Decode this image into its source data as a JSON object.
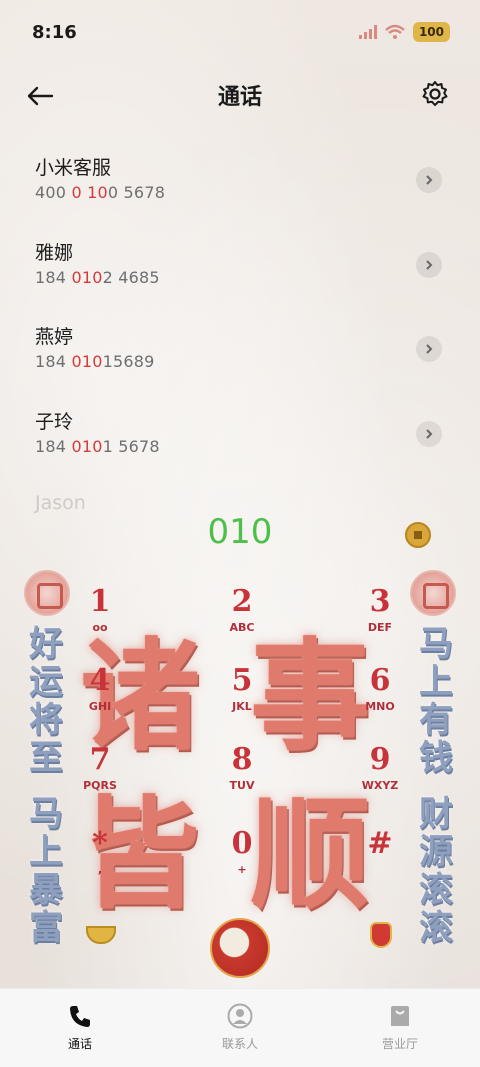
{
  "status_bar": {
    "time": "8:16",
    "battery": "100"
  },
  "header": {
    "title": "通话"
  },
  "contacts": [
    {
      "name": "小米客服",
      "num_a": "400 ",
      "num_hl": "0",
      "num_b": " ",
      "num_hl2": "10",
      "num_c": "0 5678"
    },
    {
      "name": "雅娜",
      "num_a": "184 ",
      "num_hl": "010",
      "num_b": "",
      "num_hl2": "",
      "num_c": "2 4685"
    },
    {
      "name": "燕婷",
      "num_a": "184 ",
      "num_hl": "010",
      "num_b": "",
      "num_hl2": "",
      "num_c": "15689"
    },
    {
      "name": "子玲",
      "num_a": "184 ",
      "num_hl": "010",
      "num_b": "",
      "num_hl2": "",
      "num_c": "1 5678"
    }
  ],
  "faded_contact": "Jason",
  "dial_input": "010",
  "decor": {
    "big": [
      "诸",
      "事",
      "皆",
      "顺"
    ],
    "left_top": "好运将至",
    "left_bottom": "马上暴富",
    "right_top": "马上有钱",
    "right_bottom": "财源滚滚"
  },
  "keypad": [
    {
      "digit": "1",
      "letters": "oo"
    },
    {
      "digit": "2",
      "letters": "ABC"
    },
    {
      "digit": "3",
      "letters": "DEF"
    },
    {
      "digit": "4",
      "letters": "GHI"
    },
    {
      "digit": "5",
      "letters": "JKL"
    },
    {
      "digit": "6",
      "letters": "MNO"
    },
    {
      "digit": "7",
      "letters": "PQRS"
    },
    {
      "digit": "8",
      "letters": "TUV"
    },
    {
      "digit": "9",
      "letters": "WXYZ"
    },
    {
      "digit": "*",
      "letters": ","
    },
    {
      "digit": "0",
      "letters": "+"
    },
    {
      "digit": "#",
      "letters": ""
    }
  ],
  "tabs": [
    {
      "label": "通话",
      "icon": "phone-icon",
      "active": true
    },
    {
      "label": "联系人",
      "icon": "person-icon",
      "active": false
    },
    {
      "label": "营业厅",
      "icon": "bag-icon",
      "active": false
    }
  ],
  "colors": {
    "dial_input": "#4cc04a",
    "highlight": "#d43b3b",
    "key_digit": "#c8333a"
  }
}
